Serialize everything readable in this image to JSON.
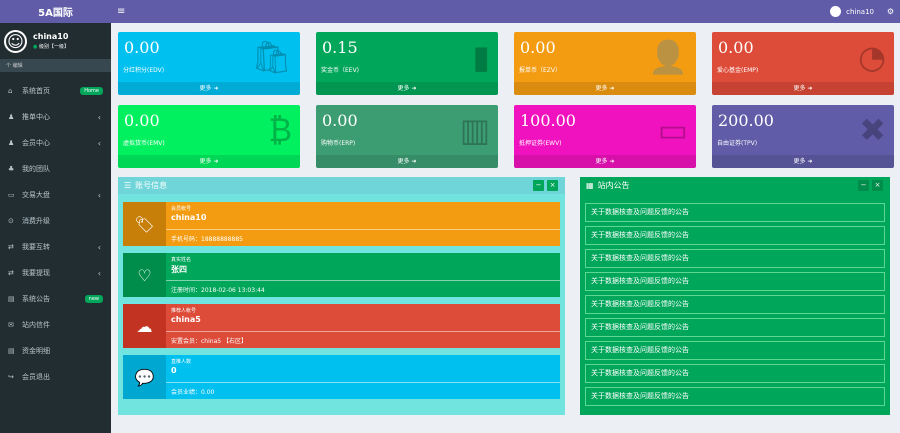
{
  "brand": "5A国际",
  "user": {
    "name": "china10",
    "status_dot": "●",
    "status": "级别【一级】"
  },
  "search": "个 编辑",
  "menu": [
    {
      "icon": "⌂",
      "label": "系统首页",
      "badge": "Home",
      "badge_color": "#00a65a"
    },
    {
      "icon": "♟",
      "label": "推单中心",
      "chev": "‹"
    },
    {
      "icon": "♟",
      "label": "会员中心",
      "chev": "‹"
    },
    {
      "icon": "♣",
      "label": "我的团队"
    },
    {
      "icon": "▭",
      "label": "交易大盘",
      "chev": "‹"
    },
    {
      "icon": "⊙",
      "label": "消费升级"
    },
    {
      "icon": "⇄",
      "label": "我要互转",
      "chev": "‹"
    },
    {
      "icon": "⇄",
      "label": "我要提现",
      "chev": "‹"
    },
    {
      "icon": "▤",
      "label": "系统公告",
      "badge": "new",
      "badge_color": "#00a65a"
    },
    {
      "icon": "✉",
      "label": "站内信件"
    },
    {
      "icon": "▤",
      "label": "资金明细"
    },
    {
      "icon": "↪",
      "label": "会员退出"
    }
  ],
  "topbar": {
    "menu_icon": "≡",
    "username": "china10",
    "gear": "⚙"
  },
  "boxes": [
    {
      "value": "0.00",
      "label": "分红积分(EDV)",
      "more": "更多 ➜",
      "color": "#00c0ef",
      "icon": "🛍"
    },
    {
      "value": "0.15",
      "label": "奖金币（EEV)",
      "more": "更多 ➜",
      "color": "#00a65a",
      "icon": "▮"
    },
    {
      "value": "0.00",
      "label": "报单币（EZV）",
      "more": "更多 ➜",
      "color": "#f39c12",
      "icon": "👤"
    },
    {
      "value": "0.00",
      "label": "爱心基金(EMP)",
      "more": "更多 ➜",
      "color": "#dd4b39",
      "icon": "◔"
    },
    {
      "value": "0.00",
      "label": "虚拟货币(EMV)",
      "more": "更多 ➜",
      "color": "#00f060",
      "icon": "₿"
    },
    {
      "value": "0.00",
      "label": "购物币(ERP)",
      "more": "更多 ➜",
      "color": "#3c9c72",
      "icon": "▥"
    },
    {
      "value": "100.00",
      "label": "抵押证券(EWV)",
      "more": "更多 ➜",
      "color": "#f012be",
      "icon": "▭"
    },
    {
      "value": "200.00",
      "label": "自由证券(TPV)",
      "more": "更多 ➜",
      "color": "#605ca8",
      "icon": "✖"
    }
  ],
  "account": {
    "title": "账号信息",
    "min": "−",
    "close": "×",
    "items": [
      {
        "label": "会员帐号",
        "value": "china10",
        "sub": "手机号码：18888888885",
        "color": "#f39c12",
        "dark": "#c87f0a",
        "icon": "🏷"
      },
      {
        "label": "真实姓名",
        "value": "张四",
        "sub": "注册时间：2018-02-06 13:03:44",
        "color": "#00a65a",
        "dark": "#008d4c",
        "icon": "♡"
      },
      {
        "label": "推荐人帐号",
        "value": "china5",
        "sub": "安置会员：china5 【右区】",
        "color": "#dd4b39",
        "dark": "#c23321",
        "icon": "☁"
      },
      {
        "label": "直推人数",
        "value": "0",
        "sub": "会员业绩：0.00",
        "color": "#00c0ef",
        "dark": "#00a7d0",
        "icon": "💬"
      }
    ]
  },
  "notices": {
    "title": "站内公告",
    "min": "−",
    "close": "×",
    "items": [
      "关于数据核查及问题反馈的公告",
      "关于数据核查及问题反馈的公告",
      "关于数据核查及问题反馈的公告",
      "关于数据核查及问题反馈的公告",
      "关于数据核查及问题反馈的公告",
      "关于数据核查及问题反馈的公告",
      "关于数据核查及问题反馈的公告",
      "关于数据核查及问题反馈的公告",
      "关于数据核查及问题反馈的公告"
    ]
  }
}
